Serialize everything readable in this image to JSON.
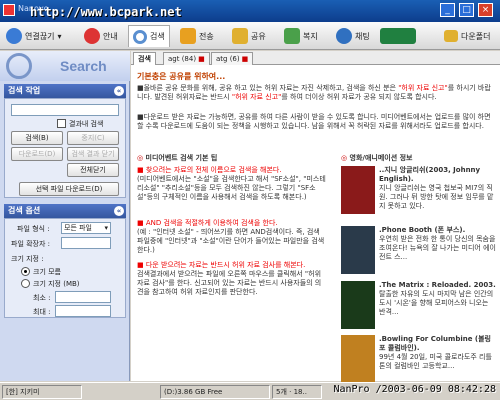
{
  "window": {
    "title": "Nanovo",
    "watermark": "http://www.bcpark.net",
    "minimize": "_",
    "maximize": "□",
    "close": "×"
  },
  "toolbar": {
    "items": [
      {
        "label": "연결끊기",
        "icon": "connect-icon",
        "color": "#3a7bd5"
      },
      {
        "label": "안내",
        "icon": "info-icon",
        "color": "#d33"
      },
      {
        "label": "검색",
        "icon": "search-icon",
        "color": "#5a8fd0"
      },
      {
        "label": "전송",
        "icon": "transfer-icon",
        "color": "#e8a020"
      },
      {
        "label": "공유",
        "icon": "share-icon",
        "color": "#e0b030"
      },
      {
        "label": "복지",
        "icon": "welfare-icon",
        "color": "#4aa04a"
      },
      {
        "label": "채팅",
        "icon": "chat-icon",
        "color": "#3070c0"
      },
      {
        "label": "",
        "icon": "status-icon",
        "color": "#208040"
      },
      {
        "label": "다운폴더",
        "icon": "folder-icon",
        "color": "#e0b030"
      }
    ]
  },
  "sidebar": {
    "banner": "Search",
    "search_panel": {
      "title": "검색 작업",
      "query_value": "",
      "result_search_label": "결과내 검색",
      "search_button": "검색(B)",
      "stop_button": "중지(C)",
      "download_button": "다운로드(D)",
      "close_result_button": "검색 결과 닫기",
      "close_all_button": "전체닫기",
      "download_selected_button": "선택 파일 다운로드(D)"
    },
    "options_panel": {
      "title": "검색 옵션",
      "file_type_label": "파일 형식 :",
      "file_type_value": "모든 파일",
      "extension_label": "파일 확장자 :",
      "extension_value": "",
      "size_label": "크기 지정 :",
      "size_all": "크기 모름",
      "size_custom": "크기 지정 (MB)",
      "min_label": "최소 :",
      "max_label": "최대 :"
    }
  },
  "main": {
    "tabs": [
      {
        "label": "검색",
        "active": true
      },
      {
        "label": "agt (84)",
        "active": false
      },
      {
        "label": "atg (6)",
        "active": false
      }
    ],
    "notice": {
      "title": "기본충은 공유를 위하여...",
      "p1a": "■올바른 공유 문화를 위해, 공유 하고 있는 허위 자료는 자진 삭제하고, 검색을 하신 분은 ",
      "p1b": "\"허위 자료 신고\"",
      "p1c": "를 하시기 바랍니다. 발견된 허위자료는 반드시 ",
      "p1d": "\"허위 자료 신고\"",
      "p1e": "를 하여 더이상 허위 자료가 공유 되지 않도록 합시다.",
      "p2": "■다운로드 받은 자료는 가능하면, 공유를 하여 다른 사람이 받을 수 있도록 합니다. 미디어벤트에서는 업로드를 많이 하면 할 수록 다운로드에 도움이 되는 정책을 시행하고 있습니다. 남을 위해서 꼭 허락된 자료를 위해서라도 업로드를 합시다."
    },
    "tips": {
      "title": "미디어벤트 검색 기본 팁",
      "t1_head": "■ 찾으려는 자료의 전체 이름으로 검색을 해본다.",
      "t1_body": "(미디어벤트에서는 \"소설\"을 검색한다고 해서 \"SF소설\", \"미스테리소설\" \"추리소설\"등을 모두 검색하진 않는다. 그렇기 \"SF소설\"등의 구체적인 이름을 사용해서 검색을 하도록 해본다.)",
      "t2_head": "■ AND 검색을 적절하게 이용하여 검색을 한다.",
      "t2_body": "(예 : \"인터넷 소설\" - 띄어쓰기를 하면 AND검색이다. 즉, 검색 파일중에 \"인터넷\"과 \"소설\"이란 단어가 들어있는 파일만을 검색한다.)",
      "t3_head": "■ 다운 받으려는 자료는 반드시 허위 자료 검사를 해본다.",
      "t3_body": "검색결과에서 받으려는 파일에 오른쪽 마우스를 클릭해서 \"허위 자료 검사\"를 한다. 신고되어 있는 자료는 반드시 사용자들의 의견을 참고하여 허위 자료인지를 판단한다."
    },
    "movies": {
      "title": "영화/애니메이션 정보",
      "items": [
        {
          "title": "..지니 앙글리쉬(2003, Johnny English).",
          "desc": "지니 앙글리쉬는 영국 첩보국 MI7의 직원. 그러나 뒤 방한 탓에 정보 임무를 맡지 못하고 있다.",
          "color": "#8a1a1a"
        },
        {
          "title": ".Phone Booth (폰 부스).",
          "desc": "우연히 받은 전화 한 통이 당신의 목숨을 조여온다! 뉴욕의 잘 나가는 미디어 에이전트 스...",
          "color": "#2a3a4a"
        },
        {
          "title": ".The Matrix : Reloaded. 2003.",
          "desc": "탈출한 자유의 도시 마지막 남은 인간의 도시 '시온'을 향해 모피어스와 니오는 반격...",
          "color": "#1a3a1a"
        },
        {
          "title": ".Bowling For Columbine (볼링 포 콜럼바인).",
          "desc": "99년 4월 20일, 미국 콜로라도주 리틀톤의 컬럼바인 고등학교...",
          "color": "#c08020"
        }
      ]
    }
  },
  "status": {
    "mode": "[한] 지키미",
    "drive": "(D:)3.86 GB Free",
    "count": "5개 · 18..",
    "stamp": "NanPro /2003-06-09 08:42:28"
  }
}
